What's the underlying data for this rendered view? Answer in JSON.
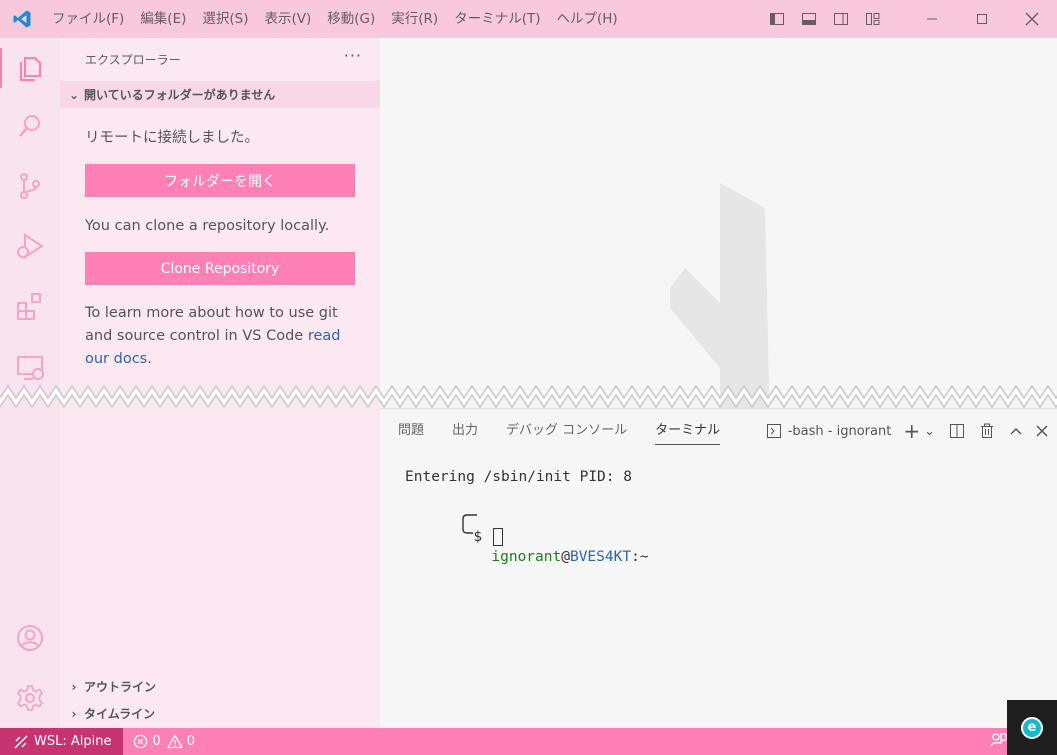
{
  "titlebar": {
    "menu": [
      "ファイル(F)",
      "編集(E)",
      "選択(S)",
      "表示(V)",
      "移動(G)",
      "実行(R)",
      "ターミナル(T)",
      "ヘルプ(H)"
    ],
    "icons": [
      "toggle-primary-sidebar-icon",
      "toggle-panel-icon",
      "toggle-secondary-sidebar-icon",
      "customize-layout-icon"
    ],
    "window_controls": [
      "minimize-icon",
      "maximize-icon",
      "close-icon"
    ]
  },
  "activitybar": {
    "items": [
      "explorer-icon",
      "search-icon",
      "source-control-icon",
      "run-debug-icon",
      "extensions-icon",
      "remote-explorer-icon"
    ],
    "bottom": [
      "account-icon",
      "settings-gear-icon"
    ]
  },
  "sidebar": {
    "title": "エクスプローラー",
    "more": "···",
    "section_title": "開いているフォルダーがありません",
    "connected_text": "リモートに接続しました。",
    "open_folder_label": "フォルダーを開く",
    "clone_text": "You can clone a repository locally.",
    "clone_label": "Clone Repository",
    "learn_text": "To learn more about how to use git and source control in VS Code",
    "learn_link": "read our docs",
    "learn_end": ".",
    "outline_label": "アウトライン",
    "timeline_label": "タイムライン"
  },
  "panel": {
    "tabs": [
      "問題",
      "出力",
      "デバッグ コンソール",
      "ターミナル"
    ],
    "active_tab": "ターミナル",
    "terminal_name": "-bash - ignorant",
    "add": "+",
    "dropdown": "⌄"
  },
  "terminal": {
    "line1": "Entering /sbin/init PID: 8",
    "user": "ignorant",
    "at": "@",
    "host": "BVES4KT",
    "path": ":~",
    "prompt": "$"
  },
  "statusbar": {
    "remote_label": "WSL: Alpine",
    "errors": "0",
    "warnings": "0"
  },
  "colors": {
    "titlebar": "#f8c8dc",
    "accent": "#ff80b5",
    "remote": "#c7336f",
    "sidebar": "#fbe8f1",
    "activitybar": "#f9e3ee"
  }
}
